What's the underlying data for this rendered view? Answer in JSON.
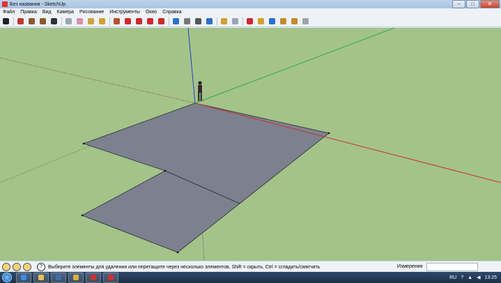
{
  "window": {
    "title": "Без названия - SketchUp",
    "buttons": [
      "–",
      "□",
      "✕"
    ]
  },
  "menu": [
    "Файл",
    "Правка",
    "Вид",
    "Камера",
    "Рисование",
    "Инструменты",
    "Окно",
    "Справка"
  ],
  "toolbar": {
    "tools": [
      {
        "name": "select-tool",
        "color": "#222222"
      },
      {
        "name": "pencil-tool",
        "color": "#c0392b"
      },
      {
        "name": "rectangle-tool",
        "color": "#8b5a2b"
      },
      {
        "name": "circle-tool",
        "color": "#8b5a2b"
      },
      {
        "name": "arc-tool",
        "color": "#333333"
      },
      {
        "name": "make-component-tool",
        "color": "#9aa5b1"
      },
      {
        "name": "eraser-tool",
        "color": "#d98fb1"
      },
      {
        "name": "tape-measure-tool",
        "color": "#caa43b"
      },
      {
        "name": "paint-bucket-tool",
        "color": "#d2a032"
      },
      {
        "name": "push-pull-tool",
        "color": "#b5542a"
      },
      {
        "name": "move-tool",
        "color": "#cc2a2a"
      },
      {
        "name": "rotate-tool",
        "color": "#cc2a2a"
      },
      {
        "name": "follow-me-tool",
        "color": "#cc2a2a"
      },
      {
        "name": "offset-tool",
        "color": "#cc2a2a"
      },
      {
        "name": "orbit-tool",
        "color": "#2a6fcc"
      },
      {
        "name": "pan-tool",
        "color": "#777777"
      },
      {
        "name": "zoom-tool",
        "color": "#555555"
      },
      {
        "name": "zoom-extents-tool",
        "color": "#2a6fcc"
      },
      {
        "name": "get-models-tool",
        "color": "#d2a032"
      },
      {
        "name": "share-model-tool",
        "color": "#9aa5b1"
      },
      {
        "name": "get-photo-texture-tool",
        "color": "#cc2a2a"
      },
      {
        "name": "add-location-tool",
        "color": "#d2a032"
      },
      {
        "name": "google-earth-tool",
        "color": "#2a6fcc"
      },
      {
        "name": "extension-warehouse-tool",
        "color": "#c58a2b"
      },
      {
        "name": "components-tool",
        "color": "#c58a2b"
      },
      {
        "name": "styles-tool",
        "color": "#9aa5b1"
      }
    ]
  },
  "status": {
    "icons": [
      "geo-location-icon",
      "credits-icon",
      "user-icon"
    ],
    "help": "?",
    "message": "Выберите элементы для удаления или перетащите через несколько элементов. Shift = скрыть, Ctrl = сгладить/смягчить",
    "measurements_label": "Измерения",
    "measurements_value": ""
  },
  "taskbar": {
    "apps": [
      {
        "name": "ie-task",
        "color": "#3a8de0"
      },
      {
        "name": "explorer-task",
        "color": "#e6c15a"
      },
      {
        "name": "media-task",
        "color": "#3f6fb0"
      },
      {
        "name": "chrome-task",
        "color": "#e0b03a"
      },
      {
        "name": "k-task",
        "color": "#d03030"
      },
      {
        "name": "sketchup-task",
        "color": "#d03030"
      }
    ],
    "tray": {
      "lang": "RU",
      "time": "13:25"
    }
  },
  "scene": {
    "colors": {
      "sky_ground": "#a3c389",
      "face": "#7d818f",
      "edge": "#2b2d36",
      "red_axis": "#c8322c",
      "green_axis": "#2ea84a",
      "blue_axis": "#2140c8"
    }
  }
}
